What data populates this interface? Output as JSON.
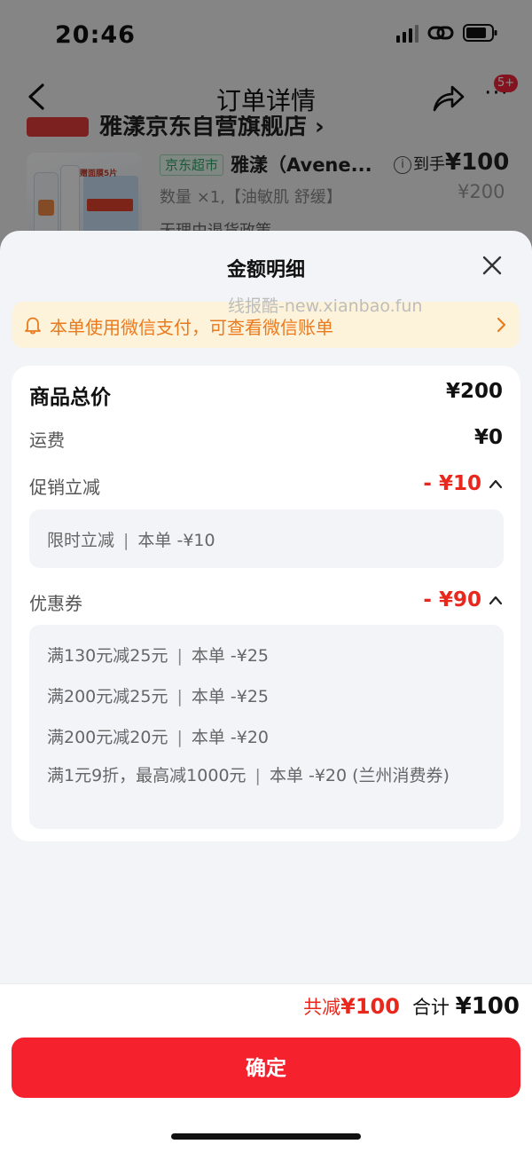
{
  "status_bar": {
    "time": "20:46"
  },
  "nav": {
    "title": "订单详情",
    "badge": "5+"
  },
  "background_order": {
    "store_name": "雅漾京东自营旗舰店 ›",
    "jd_tag": "京东超市",
    "product_title": "雅漾（Avene...",
    "price_prefix": "到手",
    "price": "¥100",
    "original_price": "¥200",
    "quantity_spec": "数量 ×1,【油敏肌 舒缓】",
    "policy": "无理由退货政策",
    "image_text": "赠面膜5片"
  },
  "sheet": {
    "title": "金额明细",
    "watermark": "线报酷-new.xianbao.fun",
    "notice": "本单使用微信支付，可查看微信账单"
  },
  "breakdown": {
    "goods_total": {
      "label": "商品总价",
      "value": "¥200"
    },
    "shipping": {
      "label": "运费",
      "value": "¥0"
    },
    "promotion": {
      "label": "促销立减",
      "value": "- ¥10",
      "items": [
        {
          "name": "限时立减",
          "detail": "本单 -¥10"
        }
      ]
    },
    "coupons": {
      "label": "优惠券",
      "value": "- ¥90",
      "items": [
        {
          "name": "满130元减25元",
          "detail": "本单 -¥25"
        },
        {
          "name": "满200元减25元",
          "detail": "本单 -¥25"
        },
        {
          "name": "满200元减20元",
          "detail": "本单 -¥20"
        },
        {
          "name": "满1元9折，最高减1000元",
          "detail": "本单 -¥20 (兰州消费券)"
        }
      ]
    }
  },
  "footer": {
    "cut_label": "共减",
    "cut_value": "¥100",
    "total_label": "合计",
    "total_value": "¥100",
    "confirm_label": "确定"
  },
  "colors": {
    "accent_red": "#f5222d",
    "notice_orange": "#ea7a1e",
    "notice_bg": "#fdf3da"
  }
}
